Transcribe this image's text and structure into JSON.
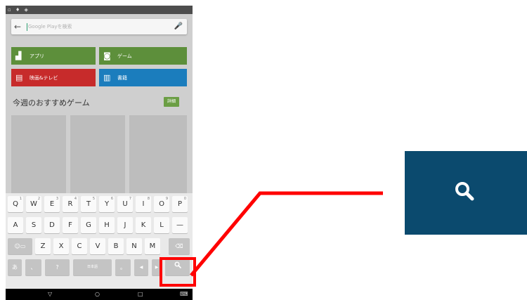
{
  "status_bar": {
    "icons": "▫ ♦ ◈"
  },
  "search": {
    "back_icon": "←",
    "placeholder": "Google Playを検索",
    "mic_icon": "🎤"
  },
  "categories": [
    {
      "label": "アプリ",
      "icon": "android-icon",
      "glyph": "▟",
      "color": "#5d8f3b"
    },
    {
      "label": "ゲーム",
      "icon": "gamepad-icon",
      "glyph": "◙",
      "color": "#5d8f3b"
    },
    {
      "label": "映画&テレビ",
      "icon": "film-icon",
      "glyph": "▤",
      "color": "#c72b2b"
    },
    {
      "label": "書籍",
      "icon": "book-icon",
      "glyph": "▥",
      "color": "#1b7dbd"
    }
  ],
  "section": {
    "title": "今週のおすすめゲーム",
    "details_label": "詳細"
  },
  "keyboard": {
    "row1": [
      {
        "label": "Q",
        "sup": "1"
      },
      {
        "label": "W",
        "sup": "2"
      },
      {
        "label": "E",
        "sup": "3"
      },
      {
        "label": "R",
        "sup": "4"
      },
      {
        "label": "T",
        "sup": "5"
      },
      {
        "label": "Y",
        "sup": "6"
      },
      {
        "label": "U",
        "sup": "7"
      },
      {
        "label": "I",
        "sup": "8"
      },
      {
        "label": "O",
        "sup": "9"
      },
      {
        "label": "P",
        "sup": "0"
      }
    ],
    "row2": [
      "A",
      "S",
      "D",
      "F",
      "G",
      "H",
      "J",
      "K",
      "L",
      "—"
    ],
    "row3": {
      "left": "☺▭",
      "keys": [
        "Z",
        "X",
        "C",
        "V",
        "B",
        "N",
        "M"
      ],
      "delete": "⌫"
    },
    "row4": {
      "kana": "あ",
      "comma": "、",
      "question": "?",
      "lang": "日本語",
      "period": "。",
      "left_arrow": "◀",
      "right_arrow": "▶",
      "search": "🔍"
    }
  },
  "nav_bar": {
    "back": "▽",
    "home": "○",
    "recent": "□",
    "keyboard": "⌨"
  },
  "zoom": {
    "icon": "search-icon",
    "color": "#0b4a6e"
  },
  "callout": {
    "color": "#ff0000"
  }
}
